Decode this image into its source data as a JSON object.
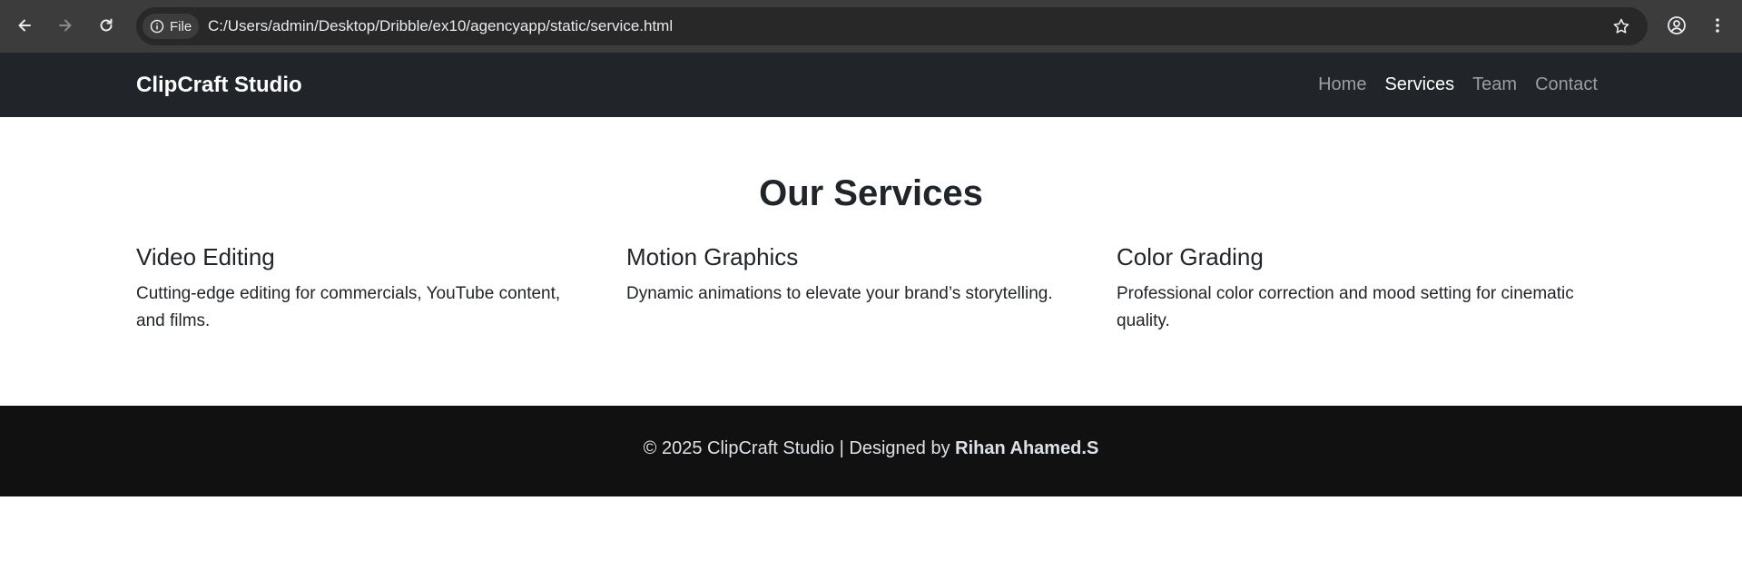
{
  "browser": {
    "site_chip_label": "File",
    "url": "C:/Users/admin/Desktop/Dribble/ex10/agencyapp/static/service.html",
    "icons": [
      "back-arrow-icon",
      "forward-arrow-icon",
      "reload-icon",
      "info-icon",
      "star-icon",
      "profile-icon",
      "more-vert-icon"
    ]
  },
  "navbar": {
    "brand": "ClipCraft Studio",
    "links": [
      {
        "label": "Home",
        "active": false
      },
      {
        "label": "Services",
        "active": true
      },
      {
        "label": "Team",
        "active": false
      },
      {
        "label": "Contact",
        "active": false
      }
    ]
  },
  "main": {
    "title": "Our Services",
    "services": [
      {
        "title": "Video Editing",
        "description": "Cutting-edge editing for commercials, YouTube content, and films."
      },
      {
        "title": "Motion Graphics",
        "description": "Dynamic animations to elevate your brand’s storytelling."
      },
      {
        "title": "Color Grading",
        "description": "Professional color correction and mood setting for cinematic quality."
      }
    ]
  },
  "footer": {
    "prefix": "© 2025 ClipCraft Studio | Designed by ",
    "author": "Rihan Ahamed.S"
  },
  "colors": {
    "chrome": "#3c3c3c",
    "navbar": "#212529",
    "footer": "#111111",
    "text": "#212529"
  }
}
